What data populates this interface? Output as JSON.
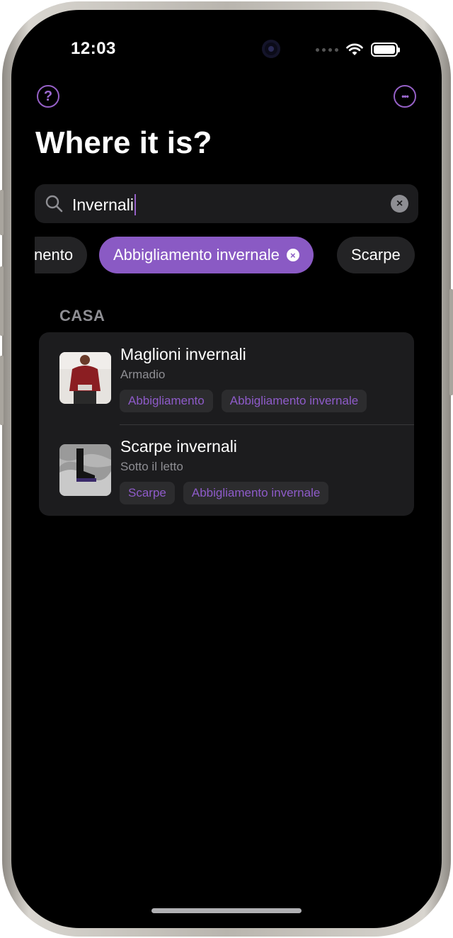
{
  "status_bar": {
    "time": "12:03"
  },
  "header": {
    "help_icon_glyph": "?",
    "more_icon_glyph": "•••",
    "title": "Where it is?"
  },
  "search": {
    "value": "Invernali",
    "clear_glyph": "×"
  },
  "filters": {
    "chips": [
      {
        "label": "nento"
      },
      {
        "label": "Abbigliamento invernale",
        "active": true
      },
      {
        "label": "Scarpe"
      }
    ],
    "chip_clear_glyph": "×"
  },
  "section": {
    "title": "CASA"
  },
  "items": [
    {
      "name": "Maglioni invernali",
      "location": "Armadio",
      "tags": [
        "Abbigliamento",
        "Abbigliamento invernale"
      ]
    },
    {
      "name": "Scarpe invernali",
      "location": "Sotto il letto",
      "tags": [
        "Scarpe",
        "Abbigliamento invernale"
      ]
    }
  ],
  "colors": {
    "accent": "#8a5ac4",
    "background": "#000000",
    "card": "#1c1c1e"
  },
  "icons": [
    "help-icon",
    "more-icon",
    "search-icon",
    "clear-icon",
    "wifi-icon",
    "battery-icon"
  ]
}
